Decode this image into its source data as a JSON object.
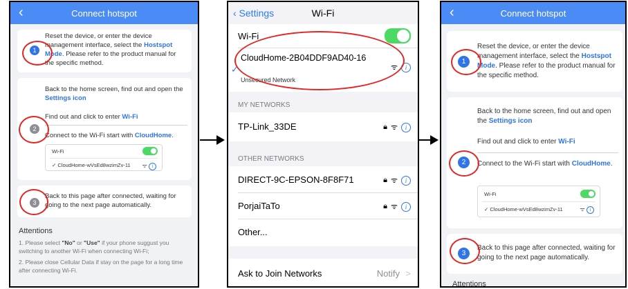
{
  "panel1": {
    "title": "Connect hotspot",
    "step1_num": "1",
    "step1_a": "Reset the device, or enter the device management interface, select the ",
    "step1_hl": "Hostspot Mode",
    "step1_b": ". Please refer to the product manual for the specific method.",
    "step2_num": "2",
    "step2_line1": "Back to the home screen, find out and open the ",
    "step2_hl1": "Settings icon",
    "step2_line2": "Find out and click to enter ",
    "step2_hl2": "Wi-Fi",
    "step2_line3": "Connect to the Wi-Fi start with ",
    "step2_hl3": "CloudHome",
    "step2_dot": ".",
    "mini_wifi": "Wi-Fi",
    "mini_network": "✓ CloudHome-wVsEd8wzimZv-11",
    "step3_num": "3",
    "step3_text": "Back to this page after connected, waiting for going to the next page automatically.",
    "attentions_title": "Attentions",
    "att1_a": "1. Please select ",
    "att1_no": "\"No\"",
    "att1_or": " or ",
    "att1_use": "\"Use\"",
    "att1_b": " if your phone suggust you switching to another Wi-Fi when connecting Wi-Fi;",
    "att2": "2. Please close Cellular Data if stay on the page for a long time after connecting Wi-Fi."
  },
  "panel2": {
    "back": "‹ Settings",
    "title": "Wi-Fi",
    "wifi_label": "Wi-Fi",
    "connected_name": "CloudHome-2B04DDF9AD40-16",
    "connected_sub": "Unsecured Network",
    "my_networks": "MY NETWORKS",
    "net_tplink": "TP-Link_33DE",
    "other_networks": "OTHER NETWORKS",
    "net_direct": "DIRECT-9C-EPSON-8F8F71",
    "net_porjai": "PorjaiTaTo",
    "net_other": "Other...",
    "ask_join": "Ask to Join Networks",
    "notify": "Notify",
    "chevron": ">"
  },
  "panel3": {
    "title": "Connect hotspot",
    "step1_num": "1",
    "step1_a": "Reset the device, or enter the device management interface, select the ",
    "step1_hl": "Hostspot Mode",
    "step1_b": ". Please refer to the product manual for the specific method.",
    "step2_num": "2",
    "step2_line1": "Back to the home screen, find out and open the ",
    "step2_hl1": "Settings icon",
    "step2_line2": "Find out and click to enter ",
    "step2_hl2": "Wi-Fi",
    "step2_line3": "Connect to the Wi-Fi start with ",
    "step2_hl3": "CloudHome",
    "step2_dot": ".",
    "mini_wifi": "Wi-Fi",
    "mini_network": "✓ CloudHome-wVsEd8wzimZv-11",
    "step3_num": "3",
    "step3_text": "Back to this page after connected, waiting for going to the next page automatically.",
    "attentions_title": "Attentions"
  },
  "icons": {
    "back": "chevron-left-icon",
    "wifi": "wifi-icon",
    "lock": "lock-icon",
    "info": "info-icon",
    "check": "checkmark-icon",
    "arrow": "arrow-right-icon"
  },
  "colors": {
    "header_blue": "#4a8bf5",
    "highlight_blue": "#2f74e8",
    "toggle_green": "#4cd964",
    "annotation_red": "#e52420",
    "step_grey": "#8d8f94"
  }
}
